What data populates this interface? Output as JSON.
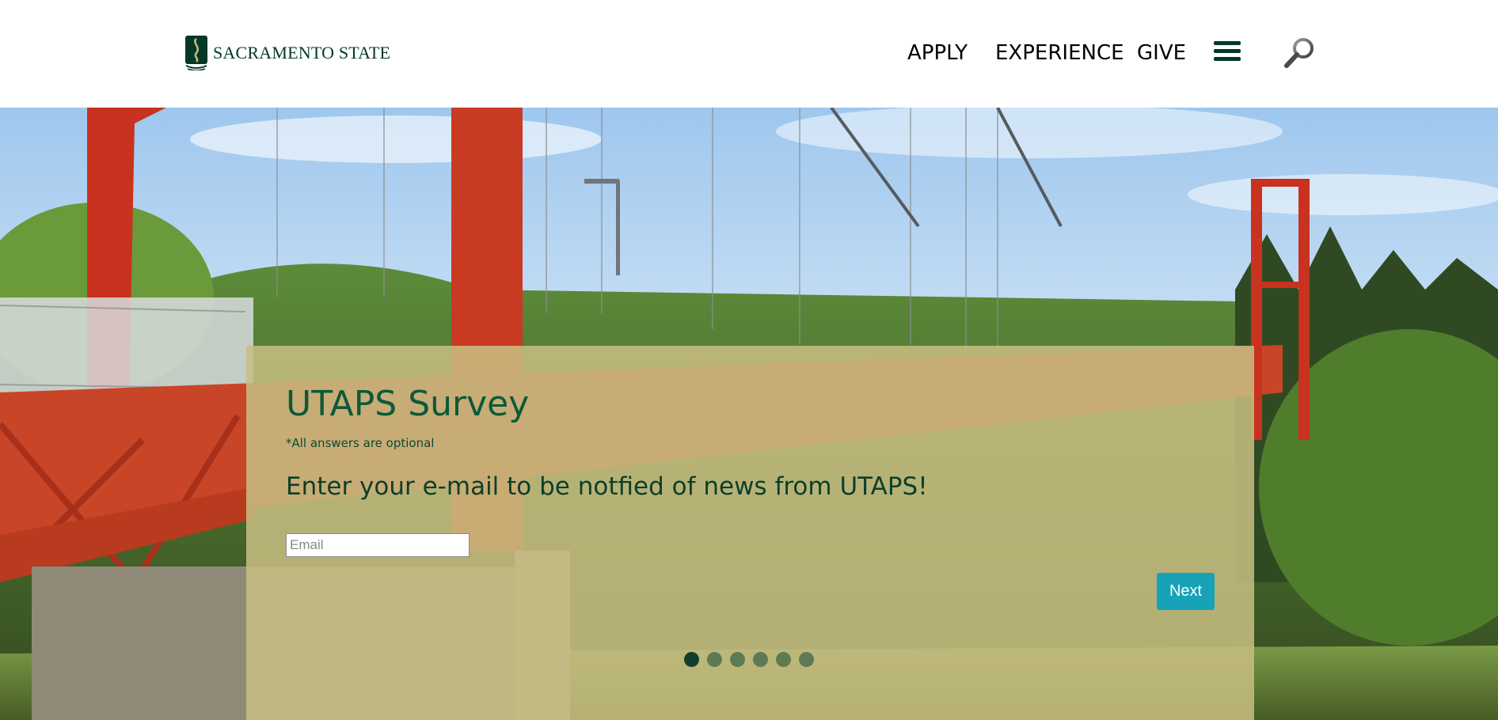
{
  "header": {
    "logo_text": "SACRAMENTO STATE",
    "nav": {
      "apply": "APPLY",
      "experience": "EXPERIENCE",
      "give": "GIVE"
    },
    "menu_icon": "hamburger-menu-icon",
    "search_icon": "search-icon"
  },
  "survey": {
    "title": "UTAPS Survey",
    "note": "*All answers are optional",
    "question": "Enter your e-mail to be notfied of news from UTAPS!",
    "email_placeholder": "Email",
    "email_value": "",
    "next_label": "Next",
    "pagination": {
      "total": 6,
      "current": 1
    }
  },
  "colors": {
    "brand_green": "#043927",
    "title_green": "#0b5a3a",
    "button_teal": "#17a2b8",
    "overlay": "#c8be82"
  }
}
